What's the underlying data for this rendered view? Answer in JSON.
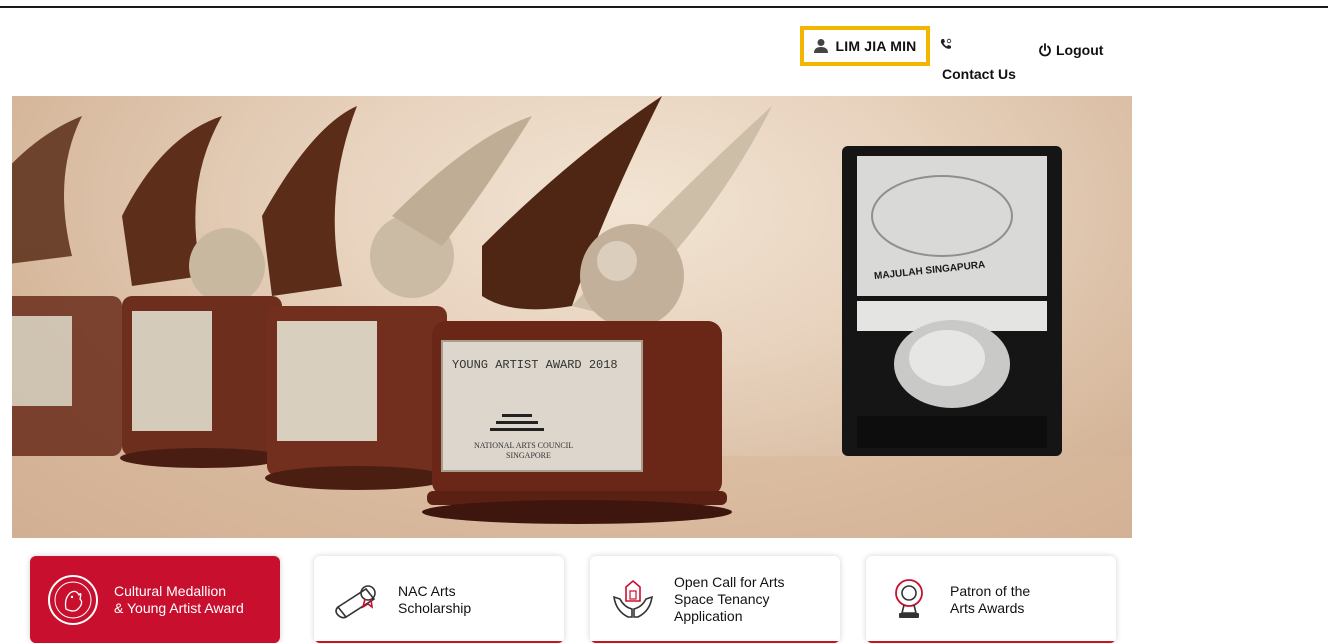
{
  "header": {
    "user_name": "LIM JIA MIN",
    "contact_label": "Contact Us",
    "logout_label": "Logout"
  },
  "hero": {
    "trophy_plate": "YOUNG ARTIST AWARD 2018",
    "trophy_sub": "NATIONAL ARTS COUNCIL",
    "trophy_sub2": "SINGAPORE",
    "medal_box_text": "MAJULAH SINGAPURA"
  },
  "cards": [
    {
      "title": "Cultural Medallion\n& Young Artist Award",
      "icon": "lion-emblem-icon",
      "active": true
    },
    {
      "title": "NAC Arts\nScholarship",
      "icon": "diploma-scroll-icon",
      "active": false
    },
    {
      "title": "Open Call for Arts\nSpace Tenancy\nApplication",
      "icon": "hands-building-icon",
      "active": false
    },
    {
      "title": "Patron of the\nArts Awards",
      "icon": "award-trophy-icon",
      "active": false
    }
  ],
  "colors": {
    "accent": "#c8102e",
    "highlight": "#f3b600"
  }
}
